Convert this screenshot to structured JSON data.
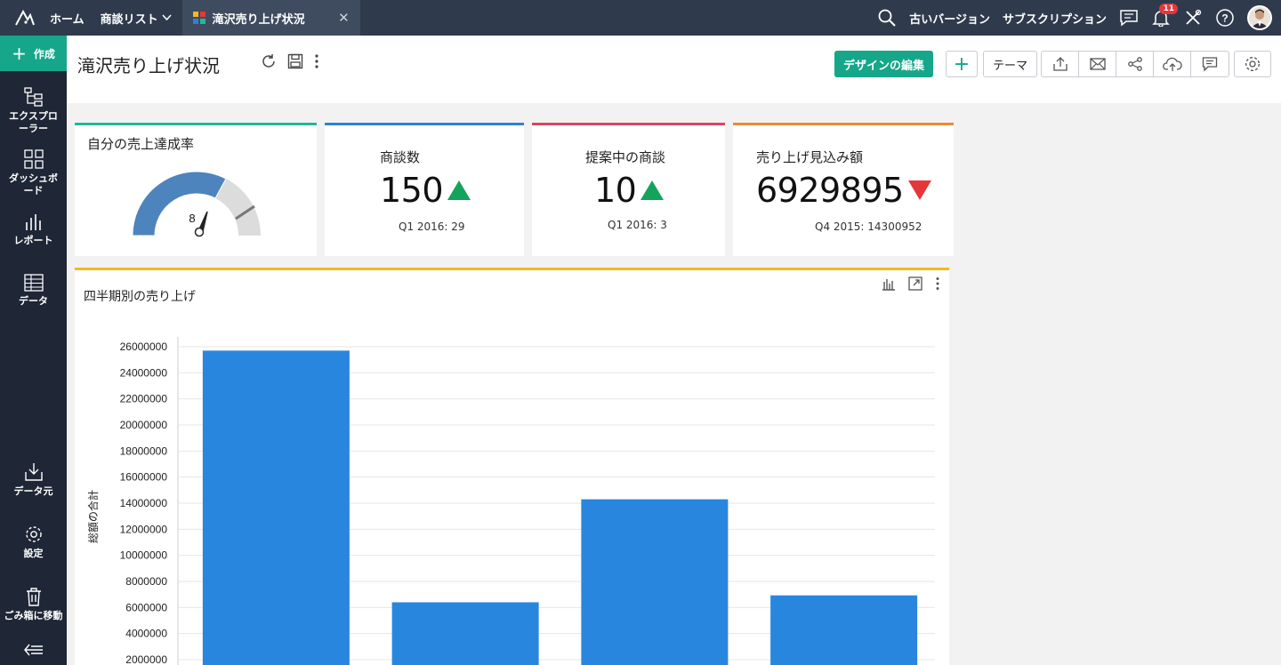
{
  "topbar": {
    "nav": [
      {
        "label": "ホーム"
      },
      {
        "label": "商談リスト"
      }
    ],
    "active_tab": "滝沢売り上げ状況",
    "right": {
      "old_version": "古いバージョン",
      "subscription": "サブスクリプション",
      "notification_count": "11"
    }
  },
  "sidebar": {
    "create": "作成",
    "items": [
      {
        "label": "エクスプローラー",
        "icon": "explorer-icon"
      },
      {
        "label": "ダッシュボード",
        "icon": "dashboard-icon"
      },
      {
        "label": "レポート",
        "icon": "report-icon"
      },
      {
        "label": "データ",
        "icon": "table-icon"
      },
      {
        "label": "データ元",
        "icon": "import-icon"
      },
      {
        "label": "設定",
        "icon": "gear-icon"
      },
      {
        "label": "ごみ箱に移動",
        "icon": "trash-icon"
      }
    ]
  },
  "header": {
    "title": "滝沢売り上げ状況",
    "design_edit": "デザインの編集",
    "plus": "+",
    "theme": "テーマ"
  },
  "widgets": {
    "gauge": {
      "title": "自分の売上達成率",
      "value": "8",
      "fraction": 0.08
    },
    "deals": {
      "title": "商談数",
      "value": "150",
      "sub": "Q1 2016: 29",
      "trend": "up"
    },
    "proposals": {
      "title": "提案中の商談",
      "value": "10",
      "sub": "Q1 2016: 3",
      "trend": "up"
    },
    "forecast": {
      "title": "売り上げ見込み額",
      "value": "6929895",
      "sub": "Q4 2015: 14300952",
      "trend": "down"
    }
  },
  "colors": {
    "accent": "#16a68a",
    "teal_line": "#1fb89a",
    "blue_line": "#2f80d6",
    "red_line": "#d9465e",
    "orange_line": "#ec8a35",
    "yellow_line": "#f5b81f",
    "bar": "#2886de",
    "up": "#14a35a",
    "down": "#e5363c"
  },
  "chart": {
    "title": "四半期別の売り上げ",
    "ylabel": "総額の合計"
  },
  "chart_data": {
    "type": "bar",
    "title": "四半期別の売り上げ",
    "xlabel": "",
    "ylabel": "総額の合計",
    "categories": [
      "",
      "",
      "",
      ""
    ],
    "values": [
      25700000,
      6400000,
      14300000,
      6930000
    ],
    "yticks": [
      "2000000",
      "4000000",
      "6000000",
      "8000000",
      "10000000",
      "12000000",
      "14000000",
      "16000000",
      "18000000",
      "20000000",
      "22000000",
      "24000000",
      "26000000"
    ],
    "ylim": [
      0,
      26000000
    ],
    "grid": true,
    "legend": "none"
  }
}
